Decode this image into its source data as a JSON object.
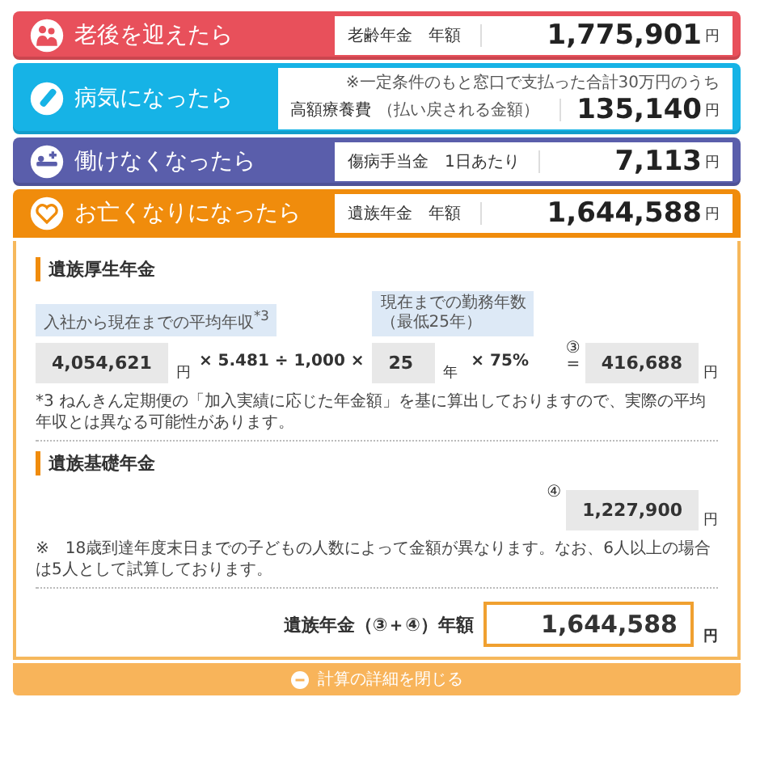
{
  "scenarios": [
    {
      "title": "老後を迎えたら",
      "color": "#e8505b",
      "label": "老齢年金　年額",
      "amount": "1,775,901",
      "unit": "円",
      "expanded": false
    },
    {
      "title": "病気になったら",
      "color": "#16b3e6",
      "note": "※一定条件のもと窓口で支払った合計30万円のうち",
      "label": "高額療養費",
      "sublabel": "（払い戻される金額）",
      "amount": "135,140",
      "unit": "円",
      "expanded": false
    },
    {
      "title": "働けなくなったら",
      "color": "#5a5eab",
      "label": "傷病手当金　1日あたり",
      "amount": "7,113",
      "unit": "円",
      "expanded": false
    },
    {
      "title": "お亡くなりになったら",
      "color": "#f08c0c",
      "label": "遺族年金　年額",
      "amount": "1,644,588",
      "unit": "円",
      "expanded": true
    }
  ],
  "detail": {
    "employee": {
      "heading": "遺族厚生年金",
      "income_caption": "入社から現在までの平均年収$^{*3}$",
      "income": "4,054,621",
      "income_unit": "円",
      "operator_1": "× 5.481 ÷ 1,000 ×",
      "years_caption": [
        "現在までの勤務年数",
        "（最低25年）"
      ],
      "years": "25",
      "years_unit": "年",
      "operator_2": "× 75%",
      "result_mark": "③",
      "equals": "=",
      "result": "416,688",
      "result_unit": "円",
      "footnote": "*3 ねんきん定期便の「加入実績に応じた年金額」を基に算出しておりますので、実際の平均年収とは異なる可能性があります。"
    },
    "basic": {
      "heading": "遺族基礎年金",
      "mark": "④",
      "amount": "1,227,900",
      "unit": "円",
      "note": "※　18歳到達年度末日までの子どもの人数によって金額が異なります。なお、6人以上の場合は5人として試算しております。"
    },
    "total": {
      "label": "遺族年金（③＋④）年額",
      "amount": "1,644,588",
      "unit": "円"
    },
    "toggle_button": "計算の詳細を閉じる"
  }
}
